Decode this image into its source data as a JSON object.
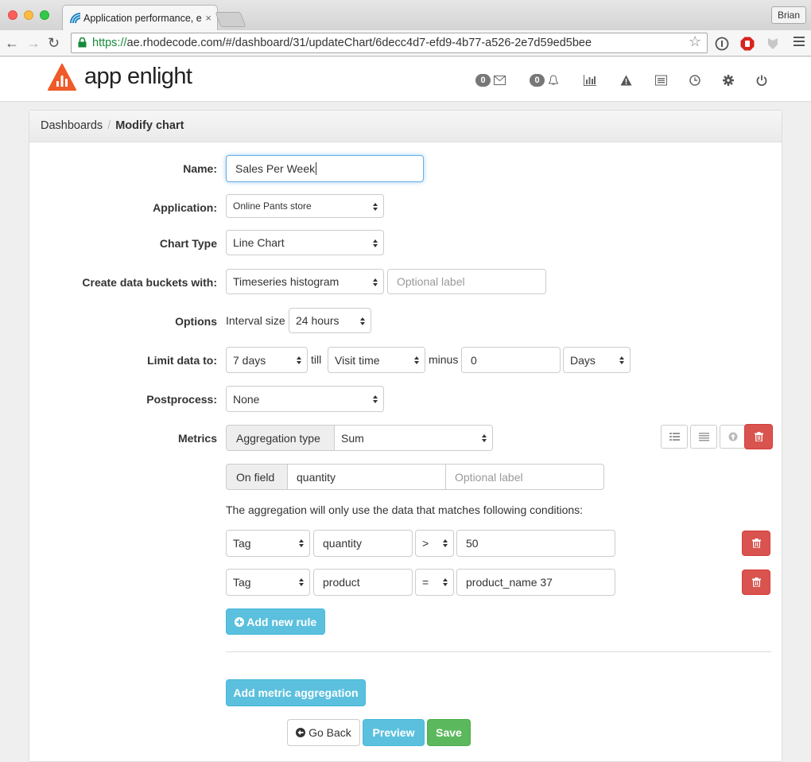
{
  "browser": {
    "tab_title": "Application performance, e",
    "tab_close": "×",
    "profile": "Brian",
    "url_scheme": "https://",
    "url_rest": "ae.rhodecode.com/#/dashboard/31/updateChart/6decc4d7-efd9-4b77-a526-2e7d59ed5bee"
  },
  "header": {
    "logo_text": "app enlight",
    "messages_count": "0",
    "notifications_count": "0"
  },
  "breadcrumb": {
    "parent": "Dashboards",
    "separator": "/",
    "current": "Modify chart"
  },
  "form": {
    "name_label": "Name:",
    "name_value": "Sales Per Week",
    "application_label": "Application:",
    "application_value": "Online Pants store",
    "chart_type_label": "Chart Type",
    "chart_type_value": "Line Chart",
    "buckets_label": "Create data buckets with:",
    "buckets_value": "Timeseries histogram",
    "buckets_label_placeholder": "Optional label",
    "options_label": "Options",
    "interval_label": "Interval size",
    "interval_value": "24 hours",
    "limit_label": "Limit data to:",
    "limit_value": "7 days",
    "till_text": "till",
    "till_value": "Visit time",
    "minus_text": "minus",
    "minus_value": "0",
    "unit_value": "Days",
    "postprocess_label": "Postprocess:",
    "postprocess_value": "None",
    "metrics_label": "Metrics",
    "aggregation_addon": "Aggregation type",
    "aggregation_value": "Sum",
    "field_addon": "On field",
    "field_value": "quantity",
    "field_label_placeholder": "Optional label",
    "conditions_text": "The aggregation will only use the data that matches following conditions:",
    "rules": [
      {
        "type": "Tag",
        "field": "quantity",
        "op": ">",
        "value": "50"
      },
      {
        "type": "Tag",
        "field": "product",
        "op": "=",
        "value": "product_name 37"
      }
    ],
    "add_rule": "Add new rule",
    "add_metric": "Add metric aggregation",
    "back": "Go Back",
    "preview": "Preview",
    "save": "Save"
  },
  "colors": {
    "info": "#5bc0de",
    "success": "#5cb85c",
    "danger": "#d9534f",
    "logo": "#f05a28"
  }
}
